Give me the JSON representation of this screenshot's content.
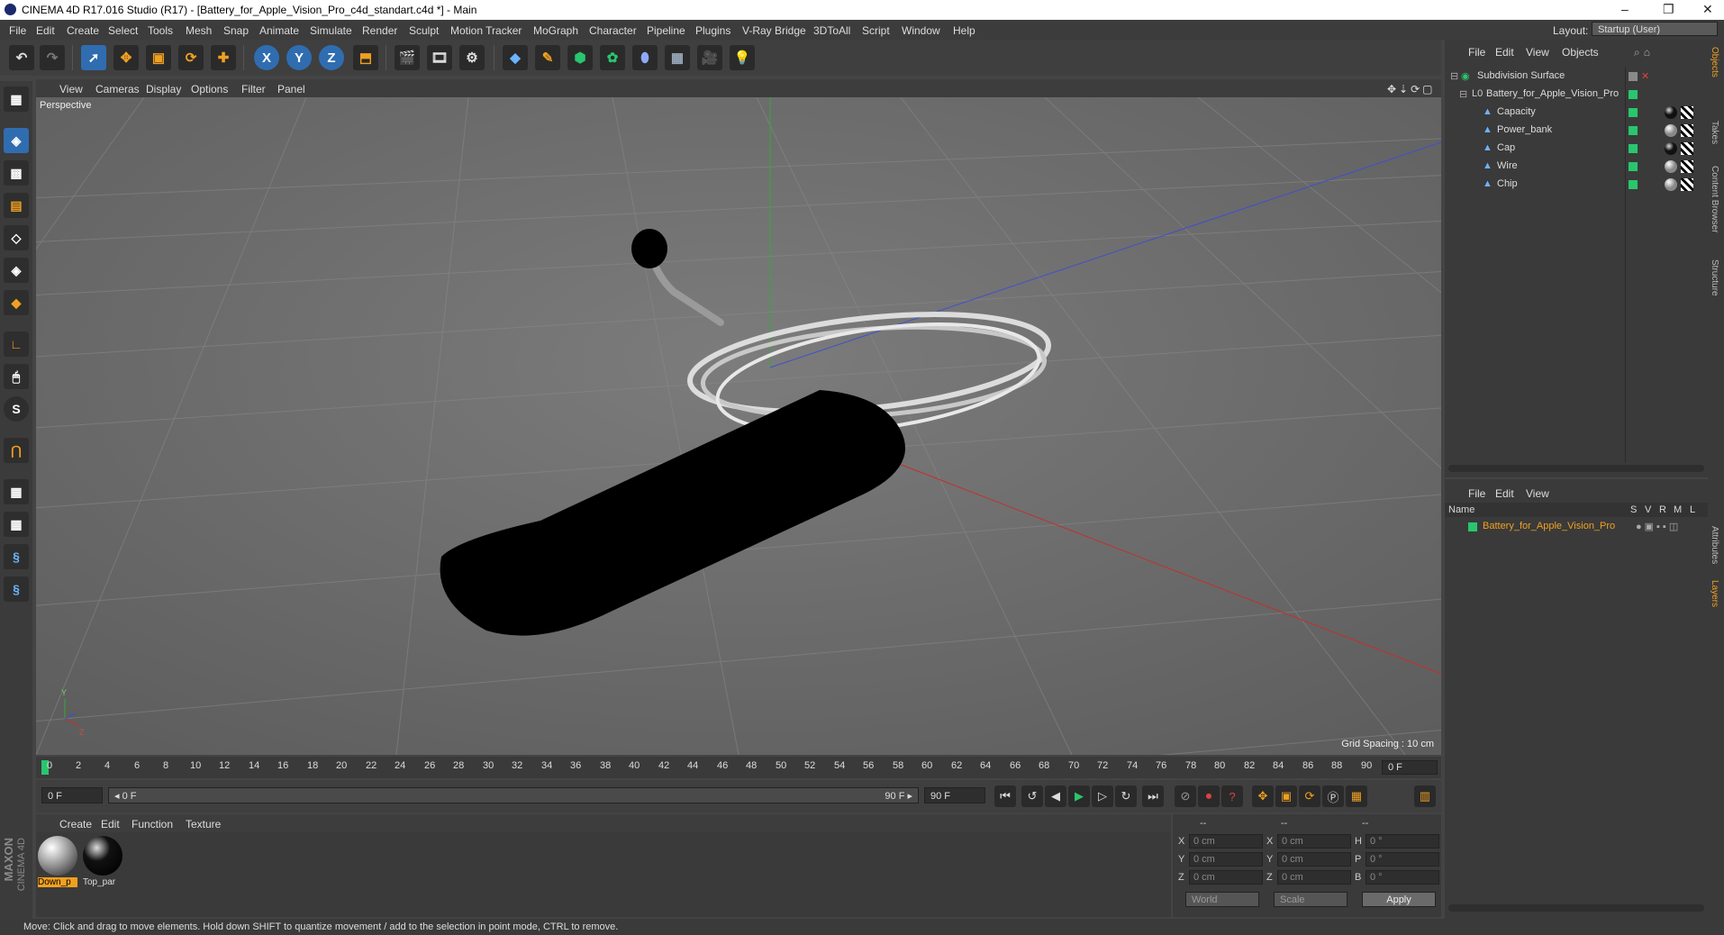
{
  "window": {
    "title": "CINEMA 4D R17.016 Studio (R17) - [Battery_for_Apple_Vision_Pro_c4d_standart.c4d *] - Main",
    "minimize": "–",
    "restore": "❐",
    "close": "✕"
  },
  "menu": [
    "File",
    "Edit",
    "Create",
    "Select",
    "Tools",
    "Mesh",
    "Snap",
    "Animate",
    "Simulate",
    "Render",
    "Sculpt",
    "Motion Tracker",
    "MoGraph",
    "Character",
    "Pipeline",
    "Plugins",
    "V-Ray Bridge",
    "3DToAll",
    "Script",
    "Window",
    "Help"
  ],
  "layout": {
    "label": "Layout:",
    "value": "Startup (User)"
  },
  "toolbar": {
    "x": "X",
    "y": "Y",
    "z": "Z"
  },
  "lefttools": {
    "s_icon": "S"
  },
  "viewport": {
    "menu": [
      "View",
      "Cameras",
      "Display",
      "Options",
      "Filter",
      "Panel"
    ],
    "label": "Perspective",
    "grid_spacing": "Grid Spacing : 10 cm",
    "axis_y": "Y",
    "axis_z": "Z"
  },
  "timeline": {
    "ticks": [
      "0",
      "2",
      "4",
      "6",
      "8",
      "10",
      "12",
      "14",
      "16",
      "18",
      "20",
      "22",
      "24",
      "26",
      "28",
      "30",
      "32",
      "34",
      "36",
      "38",
      "40",
      "42",
      "44",
      "46",
      "48",
      "50",
      "52",
      "54",
      "56",
      "58",
      "60",
      "62",
      "64",
      "66",
      "68",
      "70",
      "72",
      "74",
      "76",
      "78",
      "80",
      "82",
      "84",
      "86",
      "88",
      "90"
    ],
    "end_field": "0 F"
  },
  "playbar": {
    "start": "0 F",
    "current": "◂ 0 F",
    "range_end": "90 F ▸",
    "end": "90 F"
  },
  "materials": {
    "menu": [
      "Create",
      "Edit",
      "Function",
      "Texture"
    ],
    "items": [
      {
        "name": "Down_p",
        "selected": true
      },
      {
        "name": "Top_par",
        "selected": false
      }
    ]
  },
  "coords": {
    "header": [
      "--",
      "--",
      "--"
    ],
    "rows": [
      {
        "a": "X",
        "av": "0 cm",
        "b": "X",
        "bv": "0 cm",
        "c": "H",
        "cv": "0 °"
      },
      {
        "a": "Y",
        "av": "0 cm",
        "b": "Y",
        "bv": "0 cm",
        "c": "P",
        "cv": "0 °"
      },
      {
        "a": "Z",
        "av": "0 cm",
        "b": "Z",
        "bv": "0 cm",
        "c": "B",
        "cv": "0 °"
      }
    ],
    "world": "World",
    "scale": "Scale",
    "apply": "Apply"
  },
  "status": "Move: Click and drag to move elements. Hold down SHIFT to quantize movement / add to the selection in point mode, CTRL to remove.",
  "brand": {
    "line1": "MAXON",
    "line2": "CINEMA 4D"
  },
  "objects": {
    "menu": [
      "File",
      "Edit",
      "View",
      "Objects"
    ],
    "items": [
      {
        "name": "Subdivision Surface",
        "level": 0
      },
      {
        "name": "Battery_for_Apple_Vision_Pro",
        "level": 1
      },
      {
        "name": "Capacity",
        "level": 2
      },
      {
        "name": "Power_bank",
        "level": 2
      },
      {
        "name": "Cap",
        "level": 2
      },
      {
        "name": "Wire",
        "level": 2
      },
      {
        "name": "Chip",
        "level": 2
      }
    ]
  },
  "layers": {
    "menu": [
      "File",
      "Edit",
      "View"
    ],
    "columns": [
      "Name",
      "S",
      "V",
      "R",
      "M",
      "L"
    ],
    "items": [
      {
        "name": "Battery_for_Apple_Vision_Pro"
      }
    ]
  },
  "right_tabs": [
    "Objects",
    "Takes",
    "Content Browser",
    "Structure",
    "Attributes",
    "Layers"
  ],
  "colors": {
    "accent": "#2f6db0",
    "green": "#29c66e",
    "orange": "#f0a020"
  }
}
